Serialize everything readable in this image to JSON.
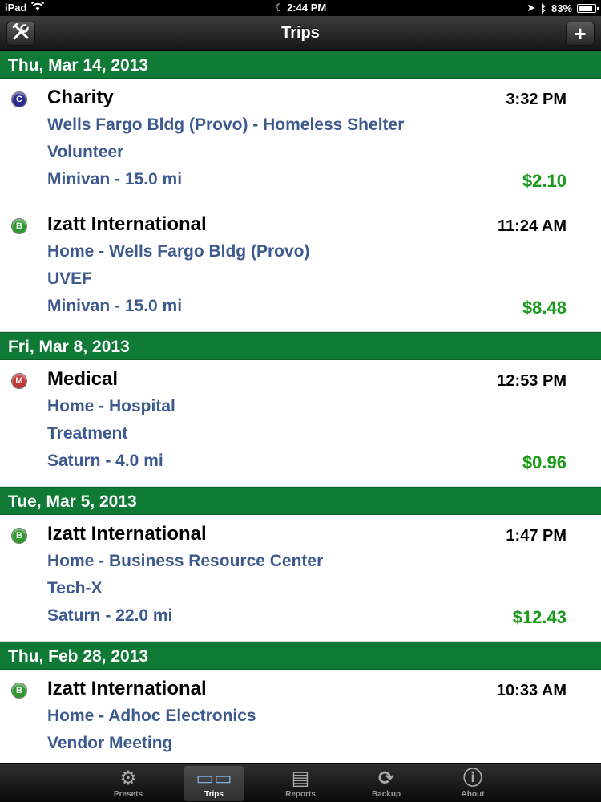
{
  "status_bar": {
    "device": "iPad",
    "time": "2:44 PM",
    "battery": "83%"
  },
  "nav": {
    "title": "Trips",
    "left_icon": "tools-icon",
    "right_label": "+"
  },
  "sections": [
    {
      "date": "Thu, Mar 14, 2013",
      "trips": [
        {
          "badge": "C",
          "badge_color": "#2b2c8f",
          "title": "Charity",
          "time": "3:32 PM",
          "route": "Wells Fargo Bldg (Provo) - Homeless Shelter",
          "purpose": "Volunteer",
          "vehicle": "Minivan - 15.0 mi",
          "amount": "$2.10"
        },
        {
          "badge": "B",
          "badge_color": "#2e9a2e",
          "title": "Izatt International",
          "time": "11:24 AM",
          "route": "Home - Wells Fargo Bldg (Provo)",
          "purpose": "UVEF",
          "vehicle": "Minivan - 15.0 mi",
          "amount": "$8.48"
        }
      ]
    },
    {
      "date": "Fri, Mar 8, 2013",
      "trips": [
        {
          "badge": "M",
          "badge_color": "#c23a3a",
          "title": "Medical",
          "time": "12:53 PM",
          "route": "Home - Hospital",
          "purpose": "Treatment",
          "vehicle": "Saturn - 4.0 mi",
          "amount": "$0.96"
        }
      ]
    },
    {
      "date": "Tue, Mar 5, 2013",
      "trips": [
        {
          "badge": "B",
          "badge_color": "#2e9a2e",
          "title": "Izatt International",
          "time": "1:47 PM",
          "route": "Home - Business Resource Center",
          "purpose": "Tech-X",
          "vehicle": "Saturn - 22.0 mi",
          "amount": "$12.43"
        }
      ]
    },
    {
      "date": "Thu, Feb 28, 2013",
      "trips": [
        {
          "badge": "B",
          "badge_color": "#2e9a2e",
          "title": "Izatt International",
          "time": "10:33 AM",
          "route": "Home - Adhoc Electronics",
          "purpose": "Vendor Meeting",
          "vehicle": "",
          "amount": ""
        }
      ]
    }
  ],
  "tabs": [
    {
      "label": "Presets",
      "icon": "gear-icon",
      "glyph": "⚙"
    },
    {
      "label": "Trips",
      "icon": "trips-icon",
      "glyph": "▭▭"
    },
    {
      "label": "Reports",
      "icon": "reports-icon",
      "glyph": "▤"
    },
    {
      "label": "Backup",
      "icon": "sync-icon",
      "glyph": "⟳"
    },
    {
      "label": "About",
      "icon": "info-icon",
      "glyph": "ⓘ"
    }
  ],
  "selected_tab": "Trips"
}
